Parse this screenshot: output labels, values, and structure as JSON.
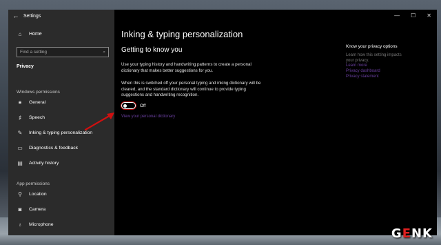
{
  "sidebar": {
    "title": "Settings",
    "home": "Home",
    "search_placeholder": "Find a setting",
    "breadcrumb": "Privacy",
    "windows_permissions": "Windows permissions",
    "items": [
      {
        "label": "General",
        "icon": "lock-icon"
      },
      {
        "label": "Speech",
        "icon": "speech-icon"
      },
      {
        "label": "Inking & typing personalization",
        "icon": "pen-icon"
      },
      {
        "label": "Diagnostics & feedback",
        "icon": "diagnostics-icon"
      },
      {
        "label": "Activity history",
        "icon": "history-icon"
      }
    ],
    "app_permissions": "App permissions",
    "app_items": [
      {
        "label": "Location",
        "icon": "location-icon"
      },
      {
        "label": "Camera",
        "icon": "camera-icon"
      },
      {
        "label": "Microphone",
        "icon": "microphone-icon"
      }
    ]
  },
  "main": {
    "title": "Inking & typing personalization",
    "subtitle": "Getting to know you",
    "paragraph1": "Use your typing history and handwriting patterns to create a personal dictionary that makes better suggestions for you.",
    "paragraph2": "When this is switched off your personal typing and inking dictionary will be cleared, and the standard dictionary will continue to provide typing suggestions and handwriting recognition.",
    "toggle_state": "Off",
    "link_dictionary": "View your personal dictionary"
  },
  "privacy_panel": {
    "title": "Know your privacy options",
    "description": "Learn how this setting impacts your privacy.",
    "links": [
      "Learn more",
      "Privacy dashboard",
      "Privacy statement"
    ]
  },
  "logo": {
    "left": "G",
    "accent": "E",
    "right": "NK"
  }
}
